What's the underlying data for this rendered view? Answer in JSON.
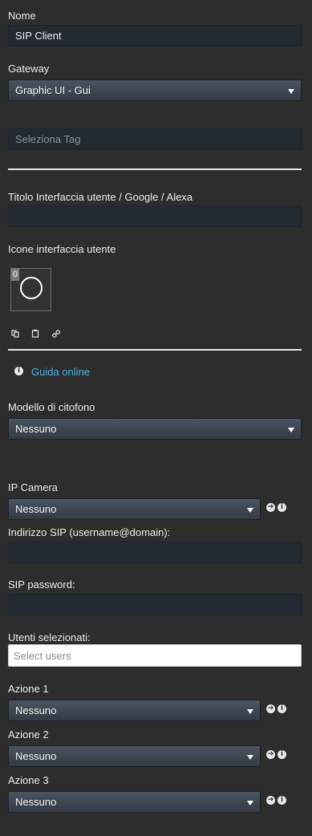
{
  "name": {
    "label": "Nome",
    "value": "SIP Client"
  },
  "gateway": {
    "label": "Gateway",
    "value": "Graphic UI - Gui"
  },
  "tags": {
    "placeholder": "Seleziona Tag"
  },
  "ui_title": {
    "label": "Titolo Interfaccia utente / Google / Alexa",
    "value": ""
  },
  "ui_icons": {
    "label": "Icone interfaccia utente",
    "badge": "0"
  },
  "help": {
    "link": "Guida online"
  },
  "intercom": {
    "label": "Modello di citofono",
    "value": "Nessuno"
  },
  "ip_camera": {
    "label": "IP Camera",
    "value": "Nessuno"
  },
  "sip_address": {
    "label": "Indirizzo SIP (username@domain):",
    "value": ""
  },
  "sip_password": {
    "label": "SIP password:",
    "value": ""
  },
  "users": {
    "label": "Utenti selezionati:",
    "placeholder": "Select users"
  },
  "actions": [
    {
      "label": "Azione 1",
      "value": "Nessuno"
    },
    {
      "label": "Azione 2",
      "value": "Nessuno"
    },
    {
      "label": "Azione 3",
      "value": "Nessuno"
    }
  ],
  "colors": {
    "background": "#2d2d2d",
    "link": "#4fb3e8",
    "input": "#242a32"
  }
}
